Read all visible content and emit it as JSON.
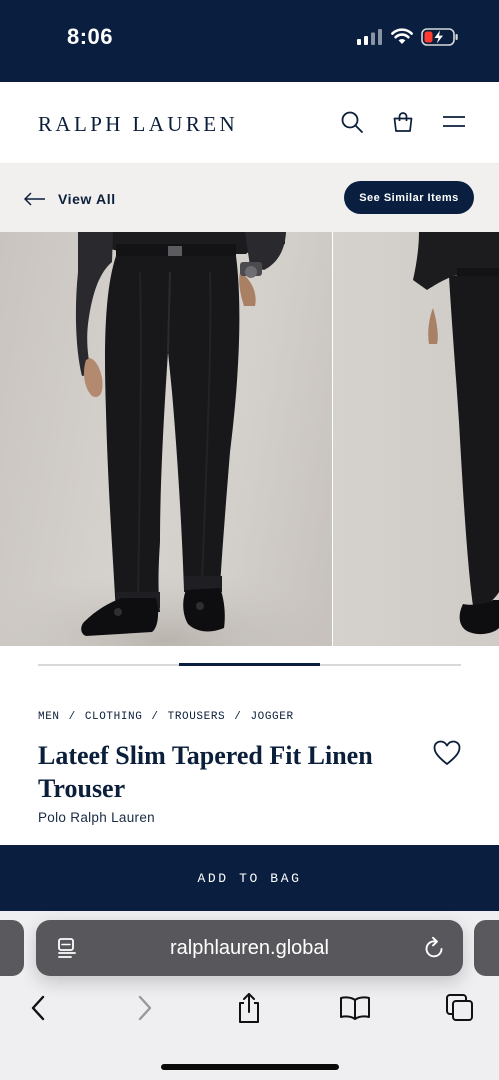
{
  "status_bar": {
    "time": "8:06"
  },
  "header": {
    "brand": "RALPH LAUREN",
    "icons": [
      "search-icon",
      "shopping-bag-icon",
      "hamburger-menu-icon"
    ]
  },
  "subnav": {
    "back_label": "View All",
    "similar_label": "See Similar Items"
  },
  "gallery": {
    "slide_count": 3,
    "active_slide": 2
  },
  "product": {
    "breadcrumb": [
      "MEN",
      "CLOTHING",
      "TROUSERS",
      "JOGGER"
    ],
    "title": "Lateef Slim Tapered Fit Linen Trouser",
    "sub_brand": "Polo Ralph Lauren"
  },
  "cta": {
    "add_to_bag": "ADD TO BAG"
  },
  "browser": {
    "url": "ralphlauren.global"
  },
  "colors": {
    "navy": "#0a1f3f",
    "toolbar_bg": "#efeff1",
    "url_bar": "#58585c"
  }
}
